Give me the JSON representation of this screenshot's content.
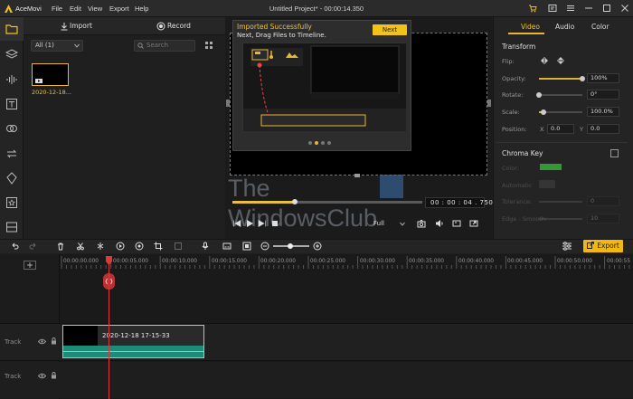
{
  "app": {
    "name": "AceMovi",
    "project_title": "Untitled Project* - 00:00:14.350"
  },
  "menu": [
    "File",
    "Edit",
    "View",
    "Export",
    "Help"
  ],
  "media": {
    "import_label": "Import",
    "record_label": "Record",
    "filter_value": "All (1)",
    "search_placeholder": "Search",
    "items": [
      {
        "name": "2020-12-18..."
      }
    ]
  },
  "popup": {
    "title": "Imported Successfully",
    "subtitle": "Next, Drag Files to Timeline.",
    "next_label": "Next",
    "page_count": 4,
    "active_page": 2
  },
  "player": {
    "time": "00 : 00 : 04 . 750",
    "progress": 0.33,
    "zoom": "Full"
  },
  "watermark": {
    "line1": "The",
    "line2": "WindowsClub"
  },
  "properties": {
    "tabs": [
      "Video",
      "Audio",
      "Color"
    ],
    "active_tab": "Video",
    "transform_title": "Transform",
    "flip_label": "Flip:",
    "opacity_label": "Opacity:",
    "opacity_value": "100%",
    "opacity_level": 1.0,
    "rotate_label": "Rotate:",
    "rotate_value": "0°",
    "rotate_level": 0.0,
    "scale_label": "Scale:",
    "scale_value": "100.0%",
    "scale_level": 0.1,
    "position_label": "Position:",
    "pos_x_label": "X",
    "pos_x_value": "0.0",
    "pos_y_label": "Y",
    "pos_y_value": "0.0",
    "chroma_title": "Chroma Key",
    "chroma_color_label": "Color:",
    "chroma_color": "#3ee63e",
    "chroma_auto_label": "Automatic",
    "chroma_tolerance_label": "Tolerance:",
    "chroma_tolerance_value": "0",
    "chroma_edge_label": "Edge - Smooth:",
    "chroma_edge_value": "10"
  },
  "toolbar": {
    "export_label": "Export"
  },
  "timeline": {
    "ticks": [
      "00:00:00.000",
      "00:00:05.000",
      "00:00:10.000",
      "00:00:15.000",
      "00:00:20.000",
      "00:00:25.000",
      "00:00:30.000",
      "00:00:35.000",
      "00:00:40.000",
      "00:00:45.000",
      "00:00:50.000",
      "00:00:55"
    ],
    "tracks": [
      {
        "label": "Track"
      },
      {
        "label": "Track"
      }
    ],
    "clip_name": "2020-12-18 17-15-33"
  },
  "colors": {
    "accent": "#f2c21b",
    "playhead": "#e03838",
    "audio_wave": "#1e8a78"
  }
}
